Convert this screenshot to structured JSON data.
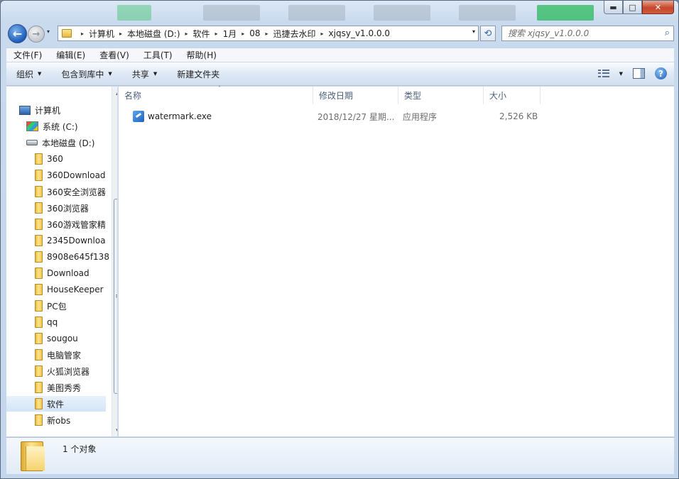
{
  "window": {
    "caption_buttons": {
      "minimize": "▬",
      "maximize": "□",
      "close": "✕"
    }
  },
  "navigation": {
    "back_icon": "back-arrow-icon",
    "forward_icon": "forward-arrow-icon",
    "back_glyph": "←",
    "forward_glyph": "→",
    "history_glyph": "▾"
  },
  "address": {
    "breadcrumbs": [
      "计算机",
      "本地磁盘 (D:)",
      "软件",
      "1月",
      "08",
      "迅捷去水印",
      "xjqsy_v1.0.0.0"
    ],
    "separator": "▸",
    "dropdown_glyph": "▾",
    "refresh_glyph": "⟲"
  },
  "search": {
    "placeholder": "搜索 xjqsy_v1.0.0.0",
    "icon_glyph": "⌕"
  },
  "menu": [
    "文件(F)",
    "编辑(E)",
    "查看(V)",
    "工具(T)",
    "帮助(H)"
  ],
  "commands": {
    "organize": "组织",
    "include_library": "包含到库中",
    "share": "共享",
    "new_folder": "新建文件夹",
    "dd_glyph": "▼",
    "help_glyph": "?"
  },
  "tree": {
    "computer": "计算机",
    "drive_c": "系统 (C:)",
    "drive_d": "本地磁盘 (D:)",
    "folders": [
      "360",
      "360Download",
      "360安全浏览器",
      "360浏览器",
      "360游戏管家精",
      "2345Downloa",
      "8908e645f138",
      "Download",
      "HouseKeeper",
      "PC包",
      "qq",
      "sougou",
      "电脑管家",
      "火狐浏览器",
      "美图秀秀",
      "软件",
      "新obs"
    ],
    "selected": "软件",
    "scroll_up": "▲",
    "scroll_down": "▼",
    "scroll_grip": "≡"
  },
  "columns": {
    "name": "名称",
    "modified": "修改日期",
    "type": "类型",
    "size": "大小",
    "sort_glyph": "˄"
  },
  "files": [
    {
      "name": "watermark.exe",
      "modified": "2018/12/27 星期...",
      "type": "应用程序",
      "size": "2,526 KB"
    }
  ],
  "status": {
    "count": "1 个对象"
  },
  "colors": {
    "accent": "#1d5db8",
    "selection": "#d4e5f8",
    "close": "#c7472c"
  }
}
